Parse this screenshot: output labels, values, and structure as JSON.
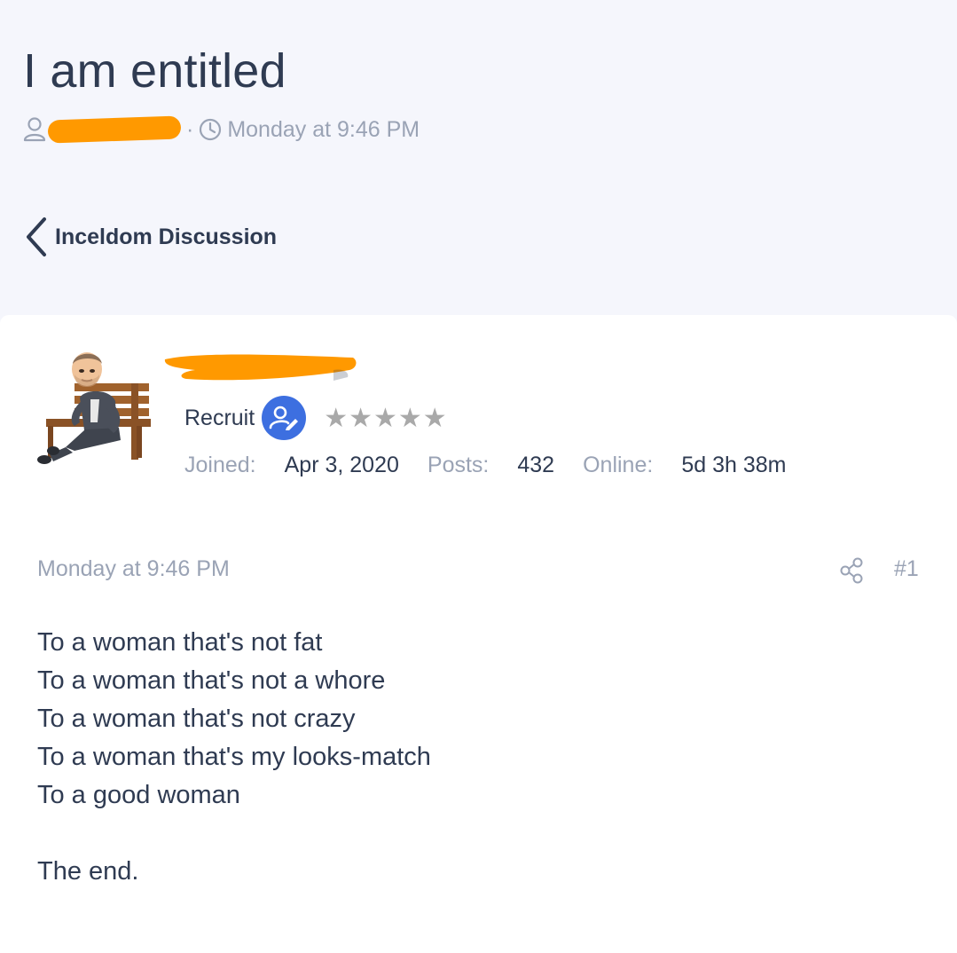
{
  "thread": {
    "title": "I am entitled",
    "posted_time": "Monday at 9:46 PM",
    "separator": "·"
  },
  "breadcrumb": {
    "label": "Inceldom Discussion"
  },
  "author": {
    "rank": "Recruit",
    "stars": "★★★★★",
    "stats": [
      {
        "key": "Joined:",
        "value": "Apr 3, 2020"
      },
      {
        "key": "Posts:",
        "value": "432"
      },
      {
        "key": "Online:",
        "value": "5d 3h 38m"
      }
    ]
  },
  "post": {
    "date": "Monday at 9:46 PM",
    "number": "#1",
    "lines": [
      "To a woman that's not fat",
      "To a woman that's not a whore",
      "To a woman that's not crazy",
      "To a woman that's my looks-match",
      "To a good woman",
      "",
      "The end."
    ]
  },
  "colors": {
    "page_bg": "#f5f6fc",
    "text": "#2f3b52",
    "muted": "#9aa3b5",
    "redaction": "#ff9900",
    "badge": "#3d6fe0",
    "stars": "#a9a9a9"
  },
  "icons": {
    "meta_user": "user-outline-icon",
    "meta_time": "clock-icon",
    "back": "chevron-left-icon",
    "badge": "user-edit-icon",
    "share": "share-icon"
  }
}
